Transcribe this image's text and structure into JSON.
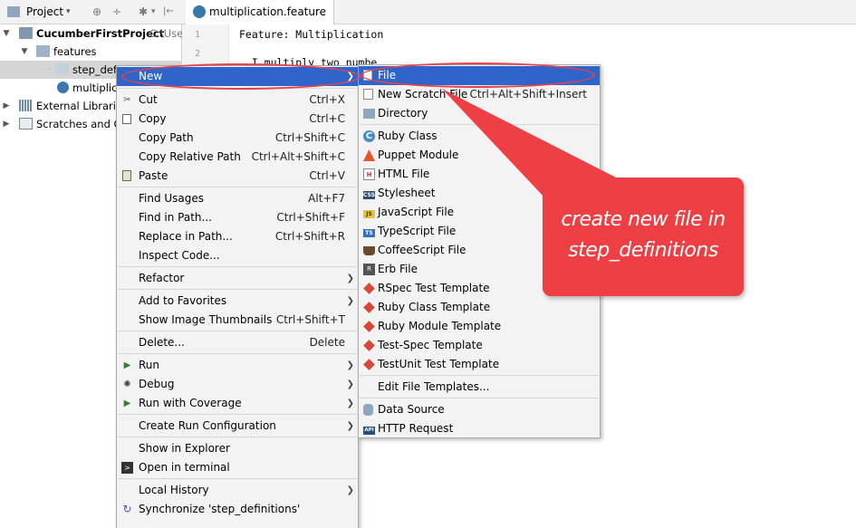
{
  "project_panel": {
    "title": "Project",
    "dropdown": "▾",
    "toolbar_icons": [
      "⊕",
      "÷",
      "✱",
      "▾",
      "|←"
    ],
    "tree": [
      {
        "label": "CucumberFirstProject",
        "suffix": "C:\\Use"
      },
      {
        "label": "features"
      },
      {
        "label": "step_defi"
      },
      {
        "label": "multiplic"
      },
      {
        "label": "External Libraries"
      },
      {
        "label": "Scratches and Co"
      }
    ]
  },
  "editor": {
    "tab_label": "multiplication.feature",
    "line_numbers": [
      "1",
      "2"
    ],
    "lines": [
      "Feature: Multiplication",
      "  I multiply two numbe"
    ]
  },
  "context_menu": {
    "items": [
      {
        "label": "New",
        "shortcut": "",
        "submenu": true
      },
      {
        "label": "Cut",
        "shortcut": "Ctrl+X"
      },
      {
        "label": "Copy",
        "shortcut": "Ctrl+C"
      },
      {
        "label": "Copy Path",
        "shortcut": "Ctrl+Shift+C"
      },
      {
        "label": "Copy Relative Path",
        "shortcut": "Ctrl+Alt+Shift+C"
      },
      {
        "label": "Paste",
        "shortcut": "Ctrl+V"
      },
      {
        "label": "Find Usages",
        "shortcut": "Alt+F7"
      },
      {
        "label": "Find in Path...",
        "shortcut": "Ctrl+Shift+F"
      },
      {
        "label": "Replace in Path...",
        "shortcut": "Ctrl+Shift+R"
      },
      {
        "label": "Inspect Code...",
        "shortcut": ""
      },
      {
        "label": "Refactor",
        "shortcut": "",
        "submenu": true
      },
      {
        "label": "Add to Favorites",
        "shortcut": "",
        "submenu": true
      },
      {
        "label": "Show Image Thumbnails",
        "shortcut": "Ctrl+Shift+T"
      },
      {
        "label": "Delete...",
        "shortcut": "Delete"
      },
      {
        "label": "Run",
        "shortcut": "",
        "submenu": true
      },
      {
        "label": "Debug",
        "shortcut": "",
        "submenu": true
      },
      {
        "label": "Run with Coverage",
        "shortcut": "",
        "submenu": true
      },
      {
        "label": "Create Run Configuration",
        "shortcut": "",
        "submenu": true
      },
      {
        "label": "Show in Explorer",
        "shortcut": ""
      },
      {
        "label": "Open in terminal",
        "shortcut": ""
      },
      {
        "label": "Local History",
        "shortcut": "",
        "submenu": true
      },
      {
        "label": "Synchronize 'step_definitions'",
        "shortcut": ""
      }
    ]
  },
  "new_menu": {
    "items": [
      {
        "label": "File",
        "shortcut": ""
      },
      {
        "label": "New Scratch File",
        "shortcut": "Ctrl+Alt+Shift+Insert"
      },
      {
        "label": "Directory",
        "shortcut": ""
      },
      {
        "label": "Ruby Class",
        "shortcut": ""
      },
      {
        "label": "Puppet Module",
        "shortcut": ""
      },
      {
        "label": "HTML File",
        "shortcut": ""
      },
      {
        "label": "Stylesheet",
        "shortcut": ""
      },
      {
        "label": "JavaScript File",
        "shortcut": ""
      },
      {
        "label": "TypeScript File",
        "shortcut": ""
      },
      {
        "label": "CoffeeScript File",
        "shortcut": ""
      },
      {
        "label": "Erb File",
        "shortcut": ""
      },
      {
        "label": "RSpec Test Template",
        "shortcut": ""
      },
      {
        "label": "Ruby Class Template",
        "shortcut": ""
      },
      {
        "label": "Ruby Module Template",
        "shortcut": ""
      },
      {
        "label": "Test-Spec Template",
        "shortcut": ""
      },
      {
        "label": "TestUnit Test Template",
        "shortcut": ""
      },
      {
        "label": "Edit File Templates...",
        "shortcut": ""
      },
      {
        "label": "Data Source",
        "shortcut": ""
      },
      {
        "label": "HTTP Request",
        "shortcut": ""
      }
    ],
    "icon_glyphs": {
      "ruby_class": "C",
      "stylesheet": "CSS",
      "javascript": "JS",
      "typescript": "TS",
      "http": "API"
    }
  },
  "callout": {
    "line1": "create new file in",
    "line2": "step_definitions"
  },
  "colors": {
    "highlight": "#2f65ca",
    "annotation": "#ee3f45",
    "menu_bg": "#f3f3f3"
  }
}
